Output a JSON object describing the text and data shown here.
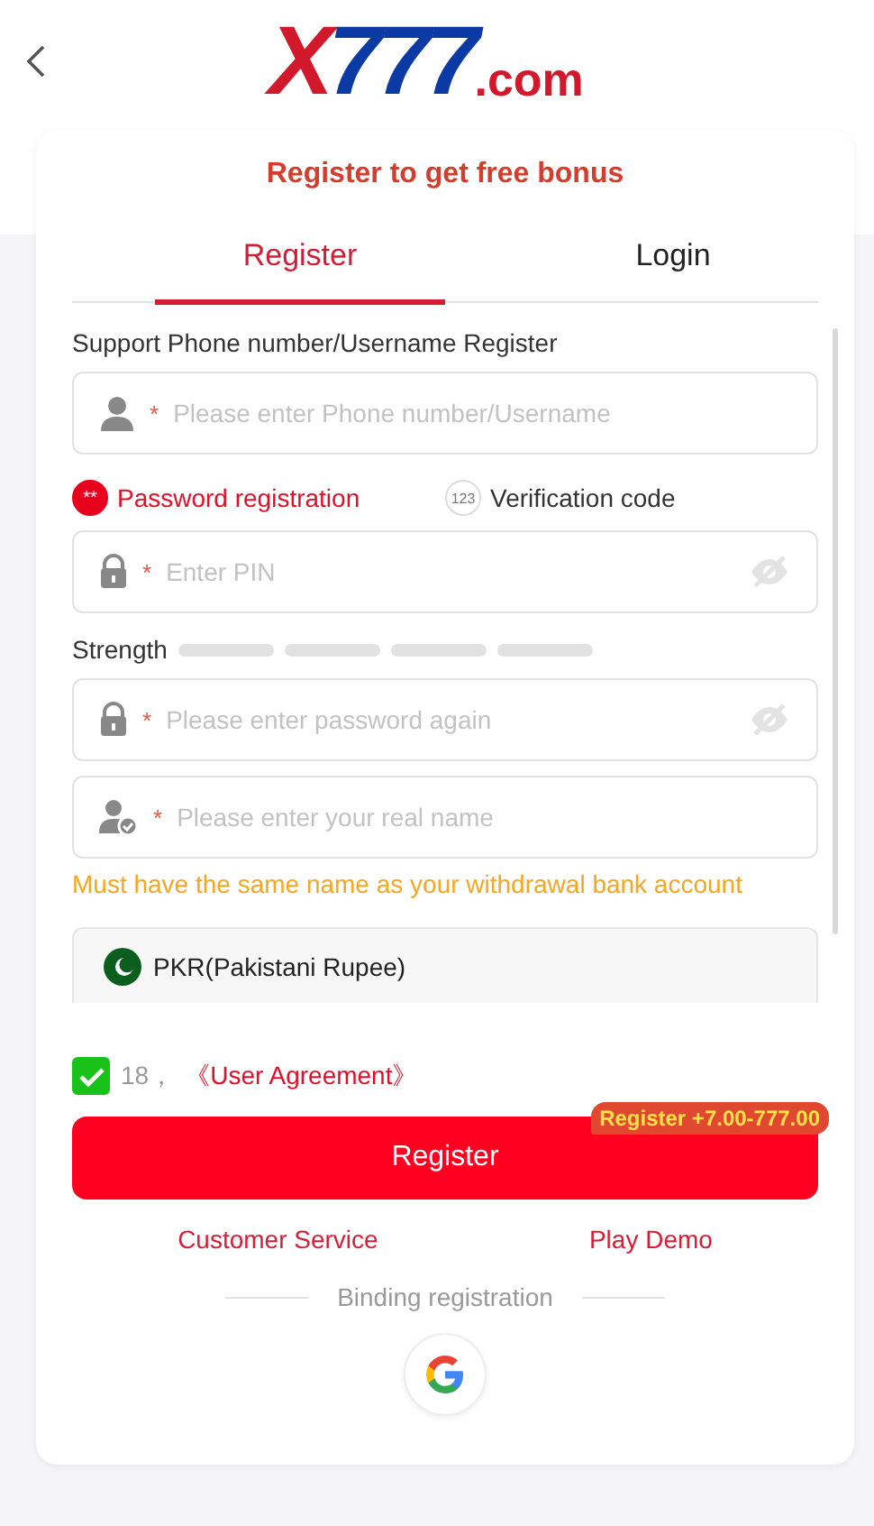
{
  "logo": {
    "brand": "X777",
    "suffix": ".com"
  },
  "promo": "Register to get free bonus",
  "tabs": [
    {
      "label": "Register",
      "selected": true
    },
    {
      "label": "Login",
      "selected": false
    }
  ],
  "form": {
    "label": "Support Phone number/Username Register",
    "username": {
      "placeholder": "Please enter Phone number/Username",
      "required": "*"
    },
    "modes": [
      {
        "icon": "**",
        "label": "Password registration",
        "selected": true
      },
      {
        "icon": "123",
        "label": "Verification code",
        "selected": false
      }
    ],
    "pin": {
      "placeholder": "Enter PIN",
      "required": "*"
    },
    "strength": {
      "label": "Strength"
    },
    "confirm": {
      "placeholder": "Please enter password again",
      "required": "*"
    },
    "real_name": {
      "placeholder": "Please enter your real name",
      "required": "*"
    },
    "hint": "Must have the same name as your withdrawal bank account",
    "currency": "PKR(Pakistani Rupee)"
  },
  "agreement": {
    "checked": true,
    "age": "18，",
    "link": "《User Agreement》"
  },
  "register_button": "Register",
  "bonus_badge": "Register +7.00-777.00",
  "links": [
    "Customer Service",
    "Play Demo"
  ],
  "binding_label": "Binding registration"
}
